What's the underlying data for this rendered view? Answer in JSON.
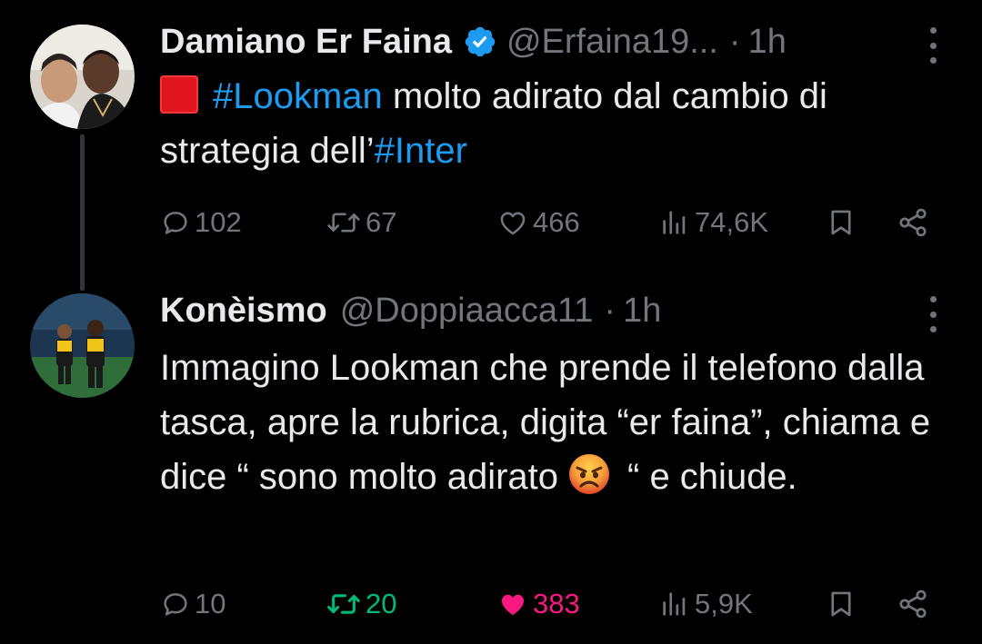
{
  "colors": {
    "background": "#000000",
    "text": "#e7e9ea",
    "muted": "#71767b",
    "hashtag": "#1d9bf0",
    "retweet_active": "#00ba7c",
    "like_active": "#f91880",
    "verified": "#1d9bf0"
  },
  "tweets": [
    {
      "author": "Damiano Er Faina",
      "verified": true,
      "handle": "@Erfaina19...",
      "dot": "·",
      "time": "1h",
      "body": {
        "emoji": "red-square",
        "hashtag1": "#Lookman",
        "text1": " molto adirato dal cambio di strategia dell’",
        "hashtag2": "#Inter"
      },
      "actions": {
        "replies": "102",
        "retweets": "67",
        "likes": "466",
        "views": "74,6K"
      },
      "retweeted": false,
      "liked": false
    },
    {
      "author": "Konèismo",
      "verified": false,
      "handle": "@Doppiaacca11",
      "dot": "·",
      "time": "1h",
      "body": {
        "text1": "Immagino Lookman che prende il telefono dalla tasca, apre la rubrica, digita “er faina”, chiama e dice “ sono molto adirato",
        "emoji": "angry-face",
        "text2": "“ e chiude."
      },
      "actions": {
        "replies": "10",
        "retweets": "20",
        "likes": "383",
        "views": "5,9K"
      },
      "retweeted": true,
      "liked": true
    }
  ]
}
